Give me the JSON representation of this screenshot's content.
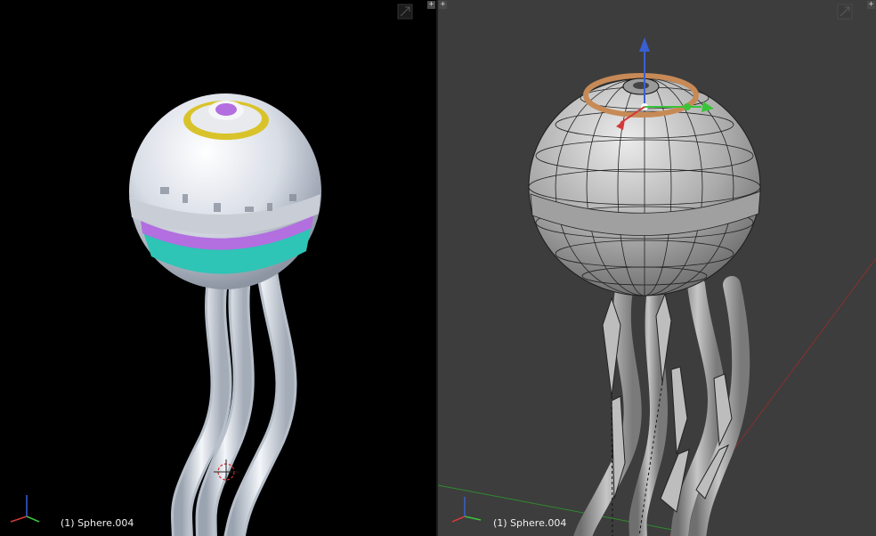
{
  "left_viewport": {
    "object_label": "(1) Sphere.004",
    "render_mode": "rendered",
    "corner_icon": "plus-icon"
  },
  "right_viewport": {
    "object_label": "(1) Sphere.004",
    "render_mode": "solid-wireframe",
    "corner_icon": "plus-icon"
  },
  "colors": {
    "left_bg": "#000000",
    "right_bg": "#3d3d3d",
    "ring_yellow": "#d9c32a",
    "ring_purple": "#b36ee0",
    "band_teal": "#2ec4b6",
    "axis_x": "#d23a3a",
    "axis_y": "#3ac43a",
    "axis_z": "#3a5fd2"
  }
}
